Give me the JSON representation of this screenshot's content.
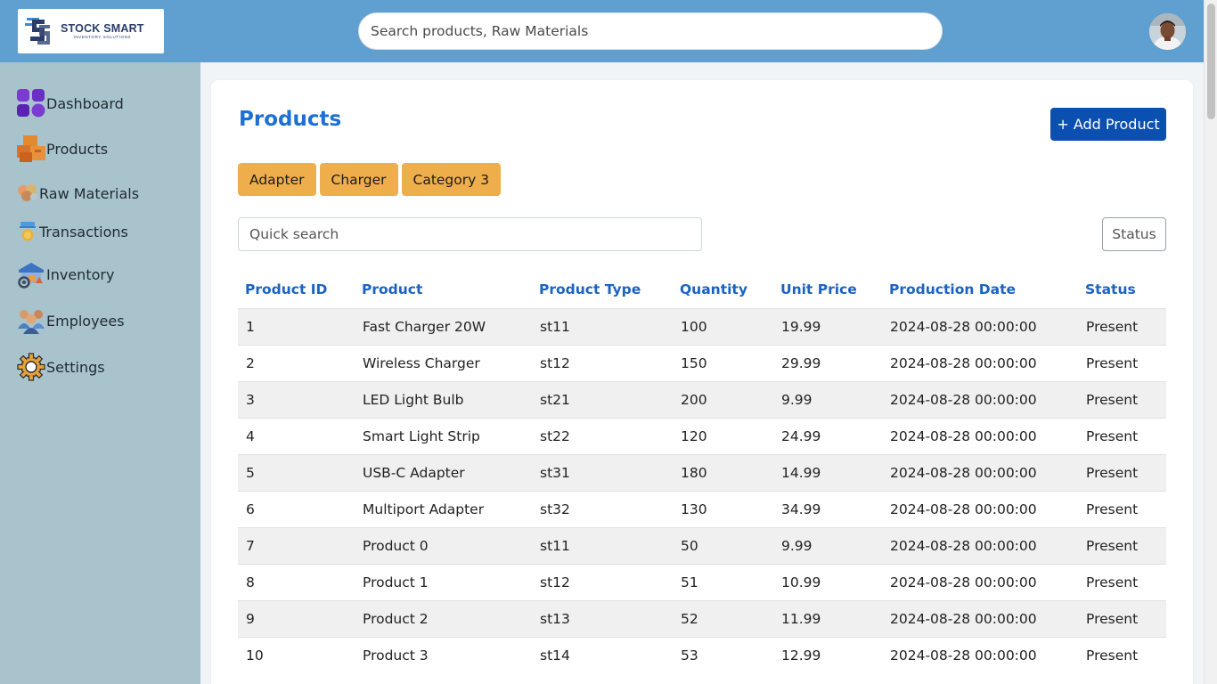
{
  "brand": {
    "title": "STOCK SMART",
    "subtitle": "INVENTORY SOLUTIONS"
  },
  "header": {
    "search_placeholder": "Search products, Raw Materials"
  },
  "sidebar": {
    "items": [
      {
        "label": "Dashboard",
        "icon": "dashboard-icon"
      },
      {
        "label": "Products",
        "icon": "boxes-icon"
      },
      {
        "label": "Raw Materials",
        "icon": "raw-materials-icon"
      },
      {
        "label": "Transactions",
        "icon": "transactions-icon"
      },
      {
        "label": "Inventory",
        "icon": "warehouse-icon"
      },
      {
        "label": "Employees",
        "icon": "employees-icon"
      },
      {
        "label": "Settings",
        "icon": "gear-icon"
      }
    ]
  },
  "main": {
    "title": "Products",
    "add_button": "+ Add Product",
    "categories": [
      "Adapter",
      "Charger",
      "Category 3"
    ],
    "quick_search_placeholder": "Quick search",
    "status_button": "Status",
    "table": {
      "columns": [
        "Product ID",
        "Product",
        "Product Type",
        "Quantity",
        "Unit Price",
        "Production Date",
        "Status"
      ],
      "rows": [
        [
          "1",
          "Fast Charger 20W",
          "st11",
          "100",
          "19.99",
          "2024-08-28 00:00:00",
          "Present"
        ],
        [
          "2",
          "Wireless Charger",
          "st12",
          "150",
          "29.99",
          "2024-08-28 00:00:00",
          "Present"
        ],
        [
          "3",
          "LED Light Bulb",
          "st21",
          "200",
          "9.99",
          "2024-08-28 00:00:00",
          "Present"
        ],
        [
          "4",
          "Smart Light Strip",
          "st22",
          "120",
          "24.99",
          "2024-08-28 00:00:00",
          "Present"
        ],
        [
          "5",
          "USB-C Adapter",
          "st31",
          "180",
          "14.99",
          "2024-08-28 00:00:00",
          "Present"
        ],
        [
          "6",
          "Multiport Adapter",
          "st32",
          "130",
          "34.99",
          "2024-08-28 00:00:00",
          "Present"
        ],
        [
          "7",
          "Product 0",
          "st11",
          "50",
          "9.99",
          "2024-08-28 00:00:00",
          "Present"
        ],
        [
          "8",
          "Product 1",
          "st12",
          "51",
          "10.99",
          "2024-08-28 00:00:00",
          "Present"
        ],
        [
          "9",
          "Product 2",
          "st13",
          "52",
          "11.99",
          "2024-08-28 00:00:00",
          "Present"
        ],
        [
          "10",
          "Product 3",
          "st14",
          "53",
          "12.99",
          "2024-08-28 00:00:00",
          "Present"
        ]
      ]
    }
  },
  "colors": {
    "header_bg": "#5fa0d0",
    "sidebar_bg": "#a9c3cc",
    "accent_blue": "#1d6fd6",
    "button_blue": "#0b4fb0",
    "category_orange": "#efae4c"
  }
}
